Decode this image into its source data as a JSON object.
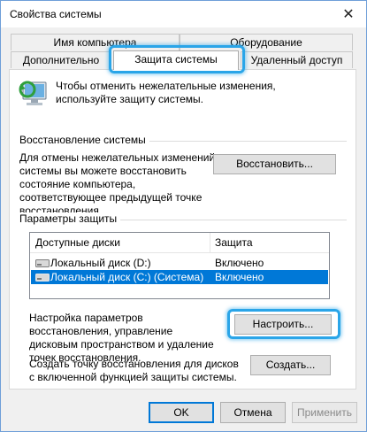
{
  "window": {
    "title": "Свойства системы",
    "close_glyph": "✕"
  },
  "tabs": {
    "row1": [
      {
        "label": "Имя компьютера"
      },
      {
        "label": "Оборудование"
      }
    ],
    "row2": [
      {
        "label": "Дополнительно"
      },
      {
        "label": "Защита системы",
        "active": true
      },
      {
        "label": "Удаленный доступ"
      }
    ]
  },
  "info": {
    "text": "Чтобы отменить нежелательные изменения, используйте защиту системы."
  },
  "restore": {
    "title": "Восстановление системы",
    "description": "Для отмены нежелательных изменений системы вы можете восстановить состояние компьютера, соответствующее предыдущей точке восстановления.",
    "button": "Восстановить..."
  },
  "protection": {
    "title": "Параметры защиты",
    "columns": [
      "Доступные диски",
      "Защита"
    ],
    "drives": [
      {
        "name": "Локальный диск (D:)",
        "status": "Включено",
        "selected": false
      },
      {
        "name": "Локальный диск (C:) (Система)",
        "status": "Включено",
        "selected": true
      }
    ],
    "configure_description": "Настройка параметров восстановления, управление дисковым пространством и удаление точек восстановления.",
    "configure_button": "Настроить...",
    "create_description": "Создать точку восстановления для дисков с включенной функцией защиты системы.",
    "create_button": "Создать..."
  },
  "footer": {
    "ok": "OK",
    "cancel": "Отмена",
    "apply": "Применить"
  },
  "colors": {
    "highlight": "#2aa5e8",
    "selection": "#0078d7"
  }
}
